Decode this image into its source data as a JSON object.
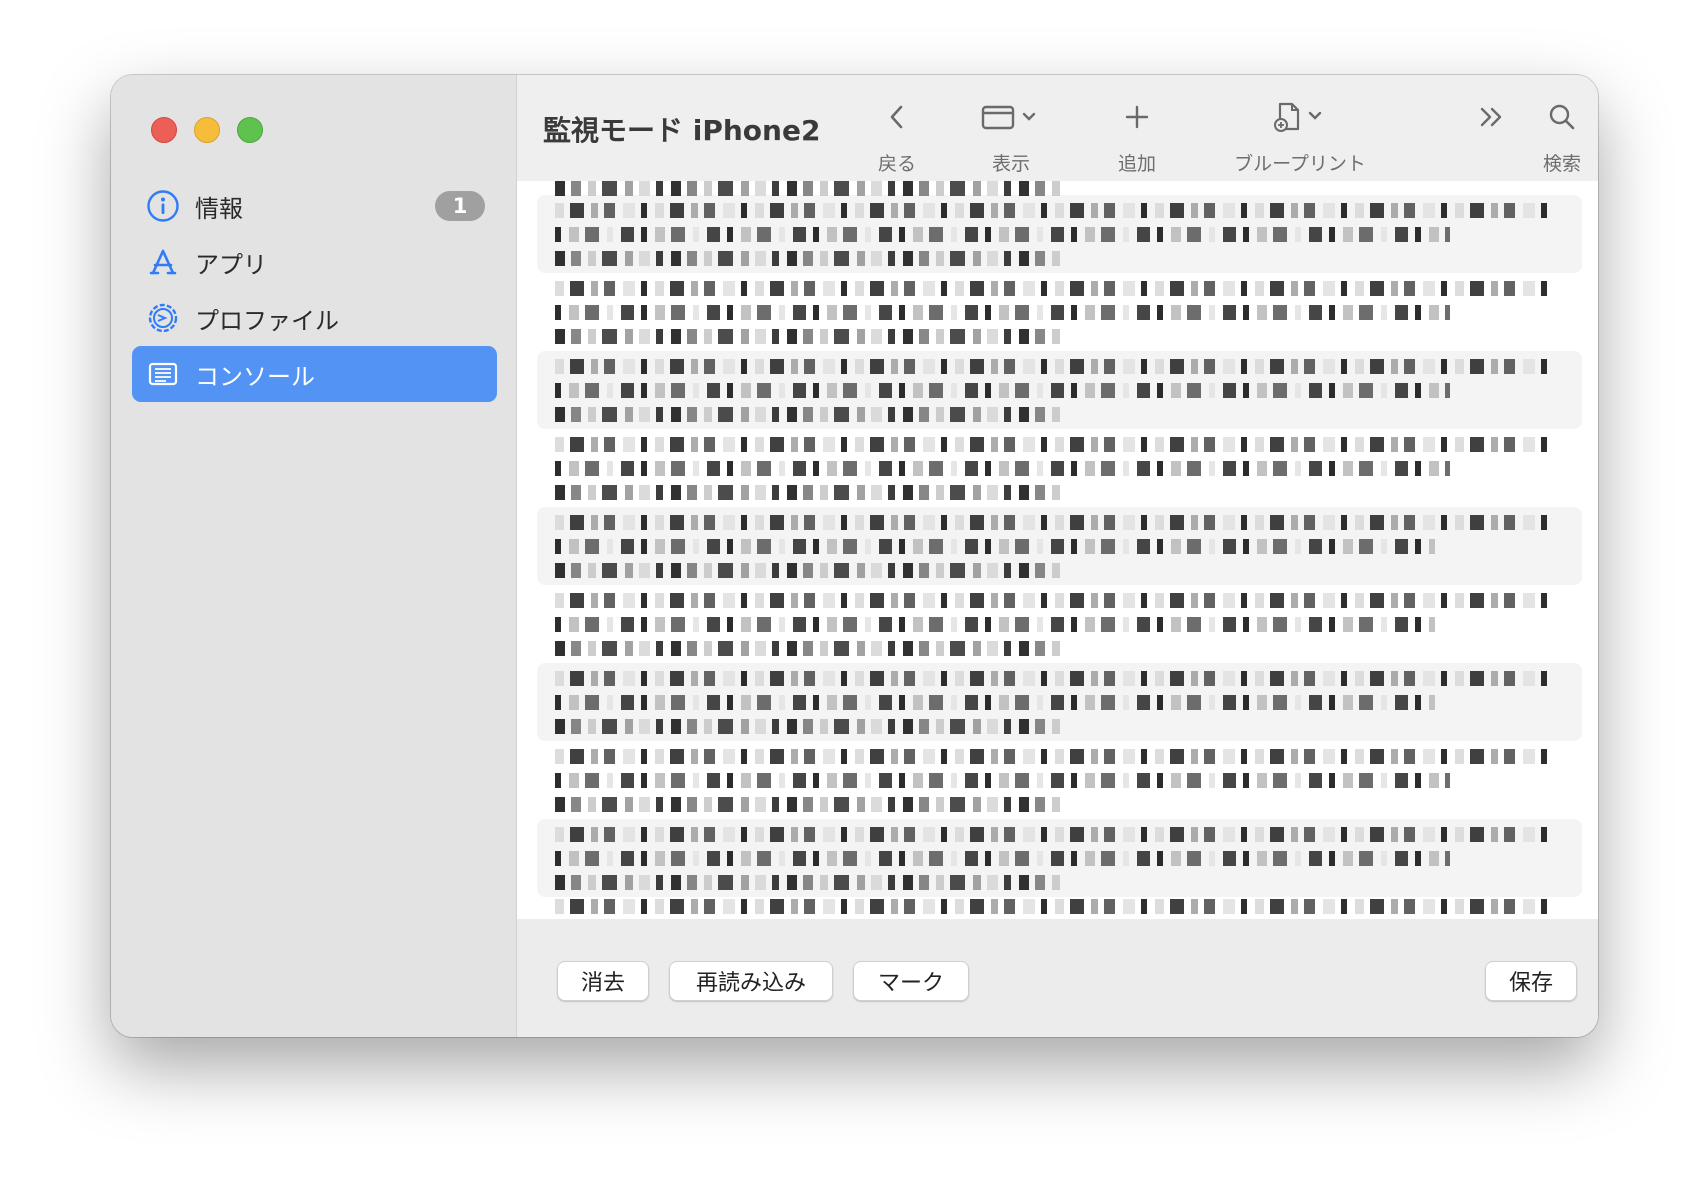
{
  "window": {
    "title": "監視モード iPhone2"
  },
  "sidebar": {
    "items": [
      {
        "label": "情報",
        "icon": "info-circle-icon",
        "badge": "1",
        "selected": false
      },
      {
        "label": "アプリ",
        "icon": "app-store-icon",
        "selected": false
      },
      {
        "label": "プロファイル",
        "icon": "gear-badge-icon",
        "selected": false
      },
      {
        "label": "コンソール",
        "icon": "console-list-icon",
        "selected": true
      }
    ]
  },
  "toolbar": {
    "back": {
      "label": "戻る",
      "icon": "chevron-left-icon"
    },
    "view": {
      "label": "表示",
      "icon": "window-view-icon"
    },
    "add": {
      "label": "追加",
      "icon": "plus-icon"
    },
    "blueprint": {
      "label": "ブループリント",
      "icon": "document-add-icon"
    },
    "more": {
      "icon": "double-chevron-right-icon"
    },
    "search": {
      "label": "検索",
      "icon": "magnifier-icon"
    }
  },
  "footer": {
    "clear_label": "消去",
    "reload_label": "再読み込み",
    "mark_label": "マーク",
    "save_label": "保存"
  },
  "colors": {
    "accent": "#5293f4",
    "close": "#ec5f57",
    "minimize": "#f6bd3b",
    "zoom": "#5fc24f",
    "badge": "#a0a0a0"
  }
}
